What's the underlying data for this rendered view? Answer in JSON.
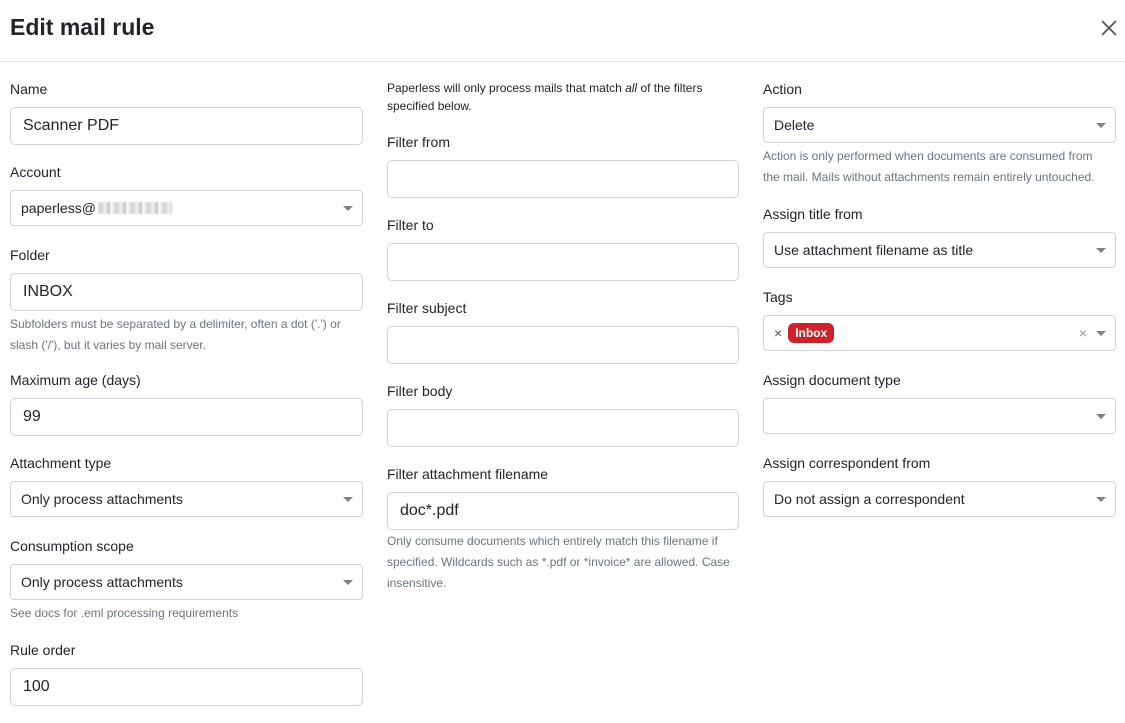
{
  "dialog": {
    "title": "Edit mail rule"
  },
  "left": {
    "name_label": "Name",
    "name_value": "Scanner PDF",
    "account_label": "Account",
    "account_value": "paperless@",
    "folder_label": "Folder",
    "folder_value": "INBOX",
    "folder_help_1": "Subfolders must be separated by a delimiter, often a dot ('.') or",
    "folder_help_2": "slash ('/'), but it varies by mail server.",
    "max_age_label": "Maximum age (days)",
    "max_age_value": "99",
    "attachment_type_label": "Attachment type",
    "attachment_type_value": "Only process attachments",
    "scope_label": "Consumption scope",
    "scope_value": "Only process attachments",
    "scope_help": "See docs for .eml processing requirements",
    "order_label": "Rule order",
    "order_value": "100"
  },
  "middle": {
    "intro_1_pre": "Paperless will only process mails that match ",
    "intro_1_em": "all",
    "intro_1_post": " of the filters",
    "intro_2": "specified below.",
    "from_label": "Filter from",
    "from_value": "",
    "to_label": "Filter to",
    "to_value": "",
    "subject_label": "Filter subject",
    "subject_value": "",
    "body_label": "Filter body",
    "body_value": "",
    "filename_label": "Filter attachment filename",
    "filename_value": "doc*.pdf",
    "filename_help_1": "Only consume documents which entirely match this filename if",
    "filename_help_2": "specified. Wildcards such as *.pdf or *invoice* are allowed. Case",
    "filename_help_3": "insensitive."
  },
  "right": {
    "action_label": "Action",
    "action_value": "Delete",
    "action_help_1": "Action is only performed when documents are consumed from",
    "action_help_2": "the mail. Mails without attachments remain entirely untouched.",
    "title_from_label": "Assign title from",
    "title_from_value": "Use attachment filename as title",
    "tags_label": "Tags",
    "tag_remove": "×",
    "tag_name": "Inbox",
    "tags_clear": "×",
    "doctype_label": "Assign document type",
    "doctype_value": "",
    "correspondent_label": "Assign correspondent from",
    "correspondent_value": "Do not assign a correspondent"
  },
  "colors": {
    "badge": "#cc2229",
    "border": "#ced4da",
    "help_text": "#6c757d"
  },
  "icons": {
    "close": "close-icon",
    "dropdown": "chevron-down-icon"
  }
}
